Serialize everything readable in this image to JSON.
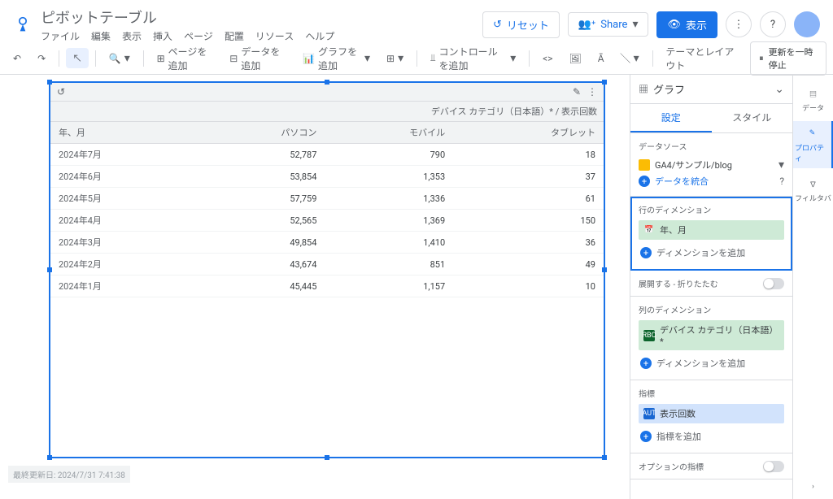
{
  "doc": {
    "title": "ピボットテーブル"
  },
  "menu": [
    "ファイル",
    "編集",
    "表示",
    "挿入",
    "ページ",
    "配置",
    "リソース",
    "ヘルプ"
  ],
  "header_actions": {
    "reset": "リセット",
    "share": "Share",
    "view": "表示"
  },
  "toolbar": {
    "add_page": "ページを追加",
    "add_data": "データを追加",
    "add_chart": "グラフを追加",
    "add_control": "コントロールを追加",
    "theme": "テーマとレイアウト",
    "pause": "更新を一時停止"
  },
  "table": {
    "crosstab_header": "デバイス カテゴリ（日本語）* / 表示回数",
    "row_header": "年、月",
    "col_headers": [
      "パソコン",
      "モバイル",
      "タブレット"
    ],
    "rows": [
      {
        "label": "2024年7月",
        "v": [
          "52,787",
          "790",
          "18"
        ]
      },
      {
        "label": "2024年6月",
        "v": [
          "53,854",
          "1,353",
          "37"
        ]
      },
      {
        "label": "2024年5月",
        "v": [
          "57,759",
          "1,336",
          "61"
        ]
      },
      {
        "label": "2024年4月",
        "v": [
          "52,565",
          "1,369",
          "150"
        ]
      },
      {
        "label": "2024年3月",
        "v": [
          "49,854",
          "1,410",
          "36"
        ]
      },
      {
        "label": "2024年2月",
        "v": [
          "43,674",
          "851",
          "49"
        ]
      },
      {
        "label": "2024年1月",
        "v": [
          "45,445",
          "1,157",
          "10"
        ]
      }
    ]
  },
  "footer": {
    "last_update": "最終更新日: 2024/7/31 7:41:38"
  },
  "panel": {
    "title": "グラフ",
    "tabs": {
      "settings": "設定",
      "style": "スタイル"
    },
    "datasource": {
      "label": "データソース",
      "name": "GA4/サンプル/blog",
      "blend": "データを統合"
    },
    "row_dim": {
      "label": "行のディメンション",
      "chip": "年、月",
      "add": "ディメンションを追加"
    },
    "expand": {
      "label": "展開する - 折りたたむ"
    },
    "col_dim": {
      "label": "列のディメンション",
      "chip": "デバイス カテゴリ（日本語）*",
      "add": "ディメンションを追加"
    },
    "metric": {
      "label": "指標",
      "chip": "表示回数",
      "add": "指標を追加"
    },
    "optional_metric": {
      "label": "オプションの指標"
    }
  },
  "rail": {
    "data": "データ",
    "property": "プロパティ",
    "filter": "フィルタバ"
  }
}
